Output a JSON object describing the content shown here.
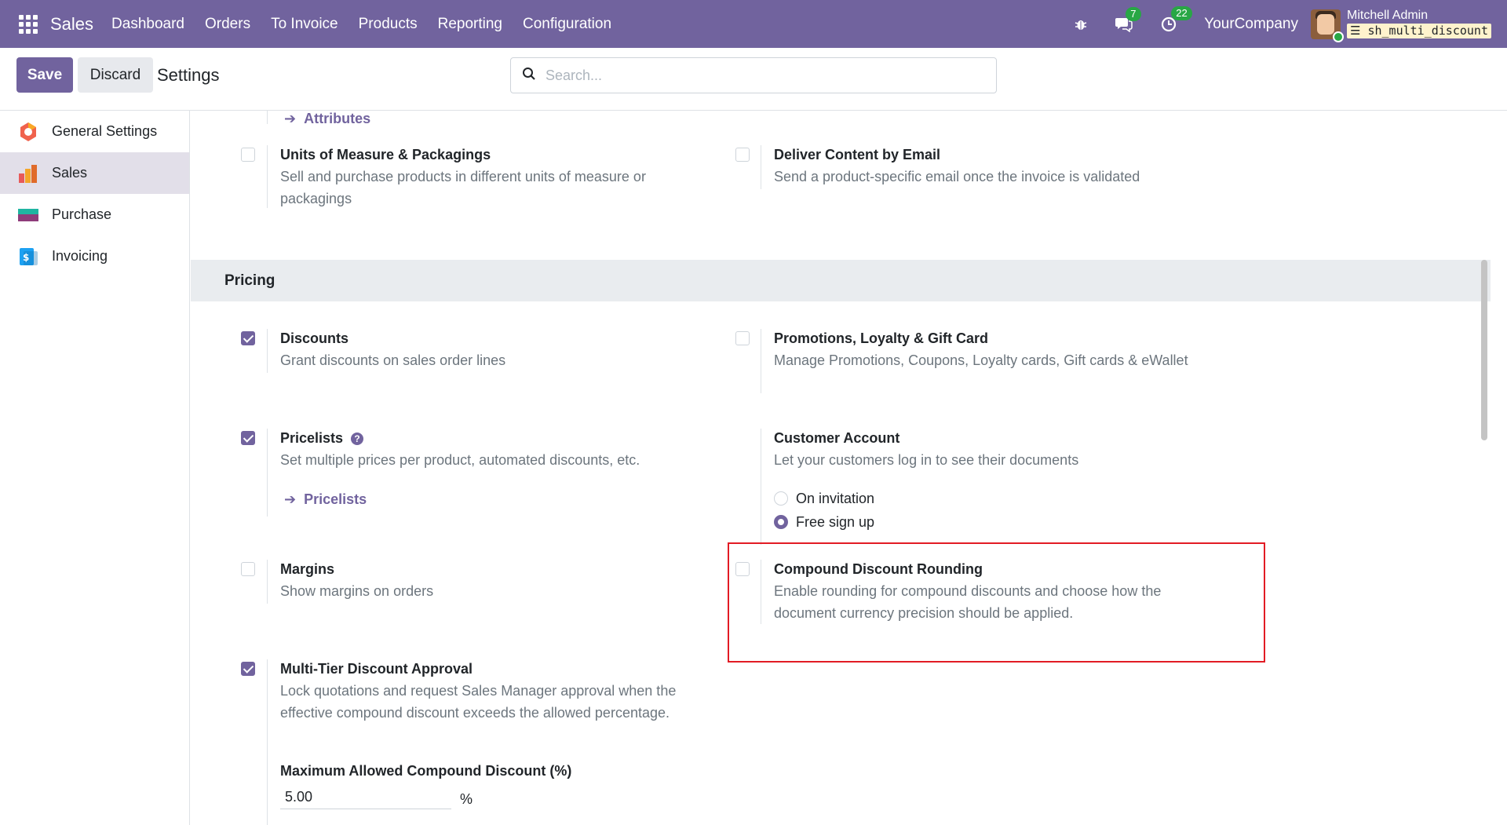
{
  "navbar": {
    "brand": "Sales",
    "menu": [
      "Dashboard",
      "Orders",
      "To Invoice",
      "Products",
      "Reporting",
      "Configuration"
    ],
    "messages_count": "7",
    "activities_count": "22",
    "company": "YourCompany",
    "user_name": "Mitchell Admin",
    "database": "sh_multi_discount"
  },
  "control_panel": {
    "save_label": "Save",
    "discard_label": "Discard",
    "title": "Settings",
    "search_placeholder": "Search..."
  },
  "sidebar": {
    "items": [
      {
        "label": "General Settings",
        "icon": "general-settings-icon"
      },
      {
        "label": "Sales",
        "icon": "sales-app-icon",
        "active": true
      },
      {
        "label": "Purchase",
        "icon": "purchase-app-icon"
      },
      {
        "label": "Invoicing",
        "icon": "invoicing-app-icon"
      }
    ]
  },
  "content": {
    "attributes_link": "Attributes",
    "uom": {
      "title": "Units of Measure & Packagings",
      "desc": "Sell and purchase products in different units of measure or packagings",
      "checked": false
    },
    "deliver_email": {
      "title": "Deliver Content by Email",
      "desc": "Send a product-specific email once the invoice is validated",
      "checked": false
    },
    "pricing_section": "Pricing",
    "discounts": {
      "title": "Discounts",
      "desc": "Grant discounts on sales order lines",
      "checked": true
    },
    "promotions": {
      "title": "Promotions, Loyalty & Gift Card",
      "desc": "Manage Promotions, Coupons, Loyalty cards, Gift cards & eWallet",
      "checked": false
    },
    "pricelists": {
      "title": "Pricelists",
      "desc": "Set multiple prices per product, automated discounts, etc.",
      "link": "Pricelists",
      "checked": true
    },
    "customer_account": {
      "title": "Customer Account",
      "desc": "Let your customers log in to see their documents",
      "options": [
        "On invitation",
        "Free sign up"
      ],
      "selected": "Free sign up"
    },
    "margins": {
      "title": "Margins",
      "desc": "Show margins on orders",
      "checked": false
    },
    "compound_rounding": {
      "title": "Compound Discount Rounding",
      "desc": "Enable rounding for compound discounts and choose how the document currency precision should be applied.",
      "checked": false
    },
    "multi_tier": {
      "title": "Multi-Tier Discount Approval",
      "desc": "Lock quotations and request Sales Manager approval when the effective compound discount exceeds the allowed percentage.",
      "checked": true,
      "field_label": "Maximum Allowed Compound Discount (%)",
      "field_value": "5.00",
      "field_unit": "%"
    }
  },
  "colors": {
    "brand": "#71639e",
    "highlight": "#e21b24"
  }
}
